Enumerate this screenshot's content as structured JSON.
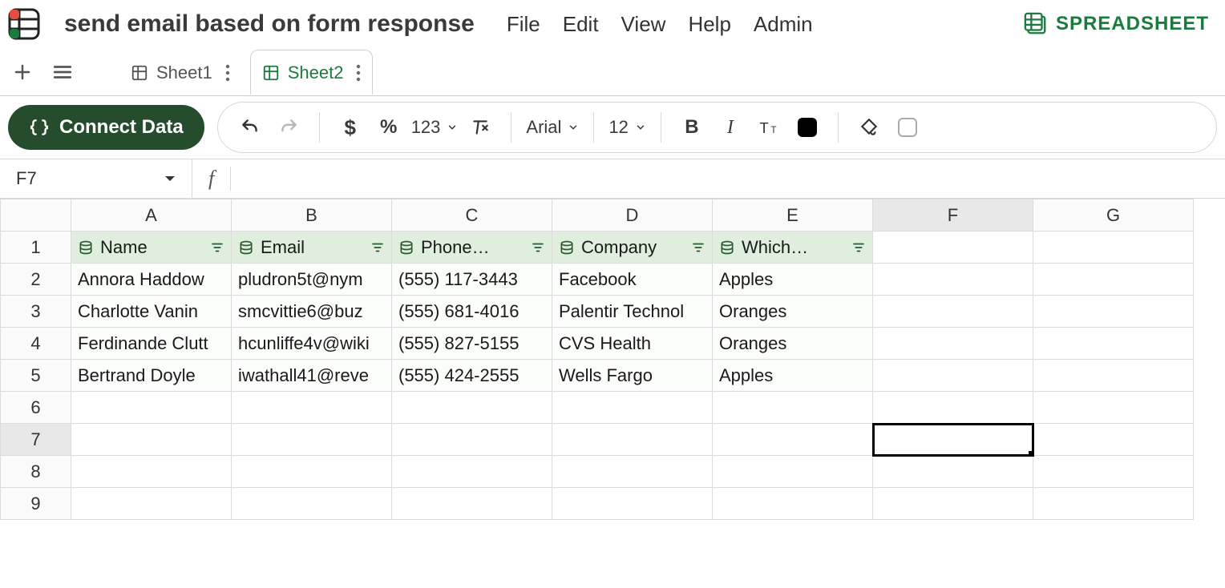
{
  "doc_title": "send email based on form response",
  "brand_label": "SPREADSHEET",
  "menu": [
    "File",
    "Edit",
    "View",
    "Help",
    "Admin"
  ],
  "tabs": [
    {
      "label": "Sheet1",
      "active": false
    },
    {
      "label": "Sheet2",
      "active": true
    }
  ],
  "connect_button": "Connect Data",
  "toolbar": {
    "font": "Arial",
    "font_size": "12",
    "number_format_label": "123"
  },
  "name_box": "F7",
  "formula_value": "",
  "columns": [
    "A",
    "B",
    "C",
    "D",
    "E",
    "F",
    "G"
  ],
  "selected_cell": {
    "col": "F",
    "row": 7
  },
  "data_headers": [
    "Name",
    "Email",
    "Phone…",
    "Company",
    "Which…"
  ],
  "rows": [
    {
      "name": "Annora Haddow",
      "email": "pludron5t@nym",
      "phone": "(555) 117-3443",
      "company": "Facebook",
      "which": "Apples"
    },
    {
      "name": "Charlotte Vanin",
      "email": "smcvittie6@buz",
      "phone": "(555) 681-4016",
      "company": "Palentir Technol",
      "which": "Oranges"
    },
    {
      "name": "Ferdinande Clutt",
      "email": "hcunliffe4v@wiki",
      "phone": "(555) 827-5155",
      "company": "CVS Health",
      "which": "Oranges"
    },
    {
      "name": "Bertrand Doyle",
      "email": "iwathall41@reve",
      "phone": "(555) 424-2555",
      "company": "Wells Fargo",
      "which": "Apples"
    }
  ],
  "row_count": 9,
  "colors": {
    "accent": "#1b7a3e",
    "connect_bg": "#254d2d",
    "header_row_bg": "#dfeedd"
  }
}
